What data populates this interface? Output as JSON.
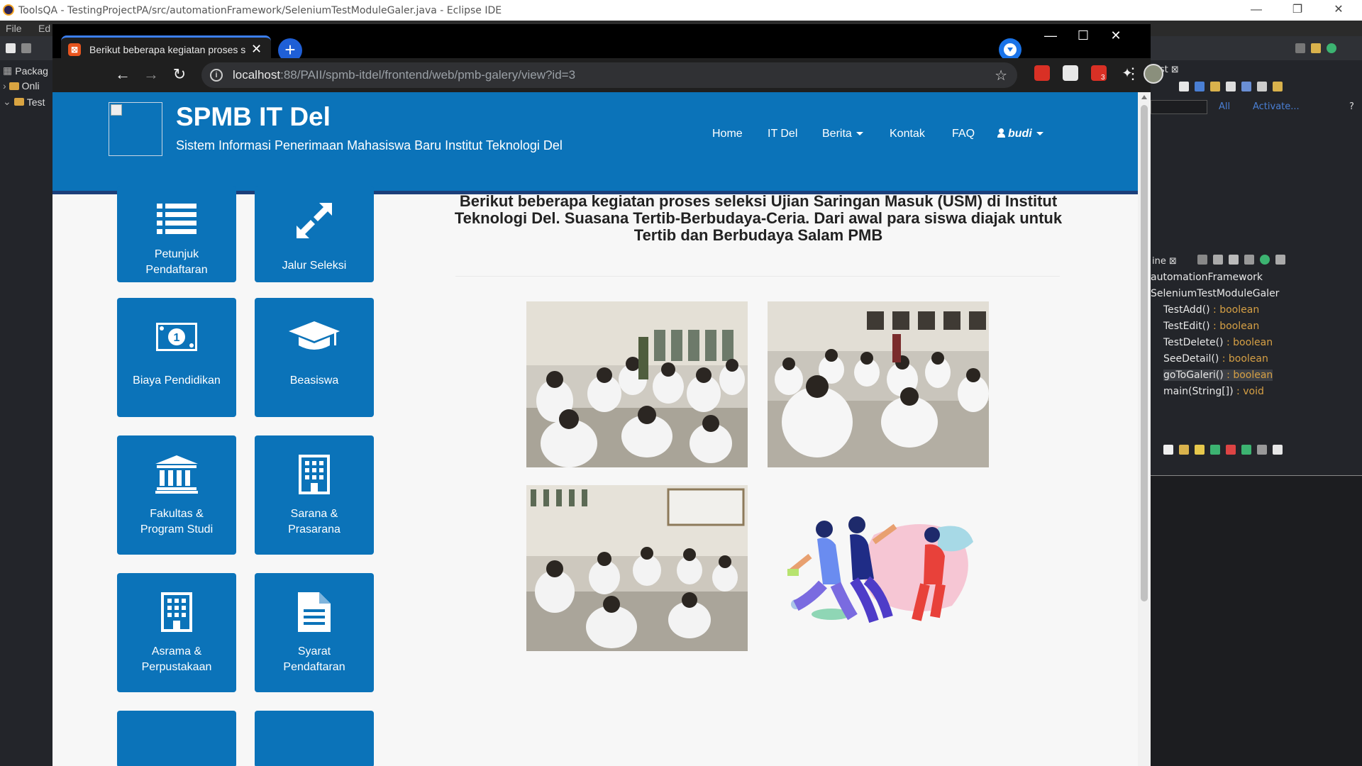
{
  "eclipse": {
    "title": "ToolsQA - TestingProjectPA/src/automationFramework/SeleniumTestModuleGaler.java - Eclipse IDE",
    "menu": [
      "File",
      "Ed"
    ],
    "package_tab": "Packag",
    "tree": [
      "Onli",
      "Test"
    ],
    "list_tab": "List",
    "filter_all": "All",
    "filter_activate": "Activate...",
    "outline_tab": "ine",
    "outline": {
      "package": "automationFramework",
      "class": "SeleniumTestModuleGaler",
      "methods": [
        {
          "name": "TestAdd()",
          "ret": " : boolean"
        },
        {
          "name": "TestEdit()",
          "ret": " : boolean"
        },
        {
          "name": "TestDelete()",
          "ret": " : boolean"
        },
        {
          "name": "SeeDetail()",
          "ret": " : boolean"
        },
        {
          "name": "goToGaleri()",
          "ret": " : boolean"
        },
        {
          "name": "main(String[])",
          "ret": " : void"
        }
      ]
    }
  },
  "browser": {
    "tab_title": "Berikut beberapa kegiatan proses seleksi",
    "url_host": "localhost",
    "url_rest": ":88/PAII/spmb-itdel/frontend/web/pmb-galery/view?id=3",
    "ext_badge": "3"
  },
  "site": {
    "title": "SPMB IT Del",
    "subtitle": "Sistem Informasi Penerimaan Mahasiswa Baru Institut Teknologi Del",
    "nav": {
      "home": "Home",
      "itdel": "IT Del",
      "berita": "Berita",
      "kontak": "Kontak",
      "faq": "FAQ",
      "user": "budi"
    },
    "tiles": [
      {
        "label1": "Petunjuk",
        "label2": "Pendaftaran",
        "icon": "list-icon"
      },
      {
        "label1": "Jalur Seleksi",
        "label2": "",
        "icon": "expand-arrows-icon"
      },
      {
        "label1": "Biaya Pendidikan",
        "label2": "",
        "icon": "money-icon"
      },
      {
        "label1": "Beasiswa",
        "label2": "",
        "icon": "graduation-cap-icon"
      },
      {
        "label1": "Fakultas &",
        "label2": "Program Studi",
        "icon": "institution-icon"
      },
      {
        "label1": "Sarana &",
        "label2": "Prasarana",
        "icon": "building-icon"
      },
      {
        "label1": "Asrama &",
        "label2": "Perpustakaan",
        "icon": "building-icon"
      },
      {
        "label1": "Syarat",
        "label2": "Pendaftaran",
        "icon": "document-icon"
      }
    ],
    "description": "Berikut beberapa kegiatan proses seleksi Ujian Saringan Masuk (USM) di Institut Teknologi Del. Suasana Tertib-Berbudaya-Ceria. Dari awal para siswa diajak untuk Tertib dan Berbudaya Salam PMB"
  }
}
